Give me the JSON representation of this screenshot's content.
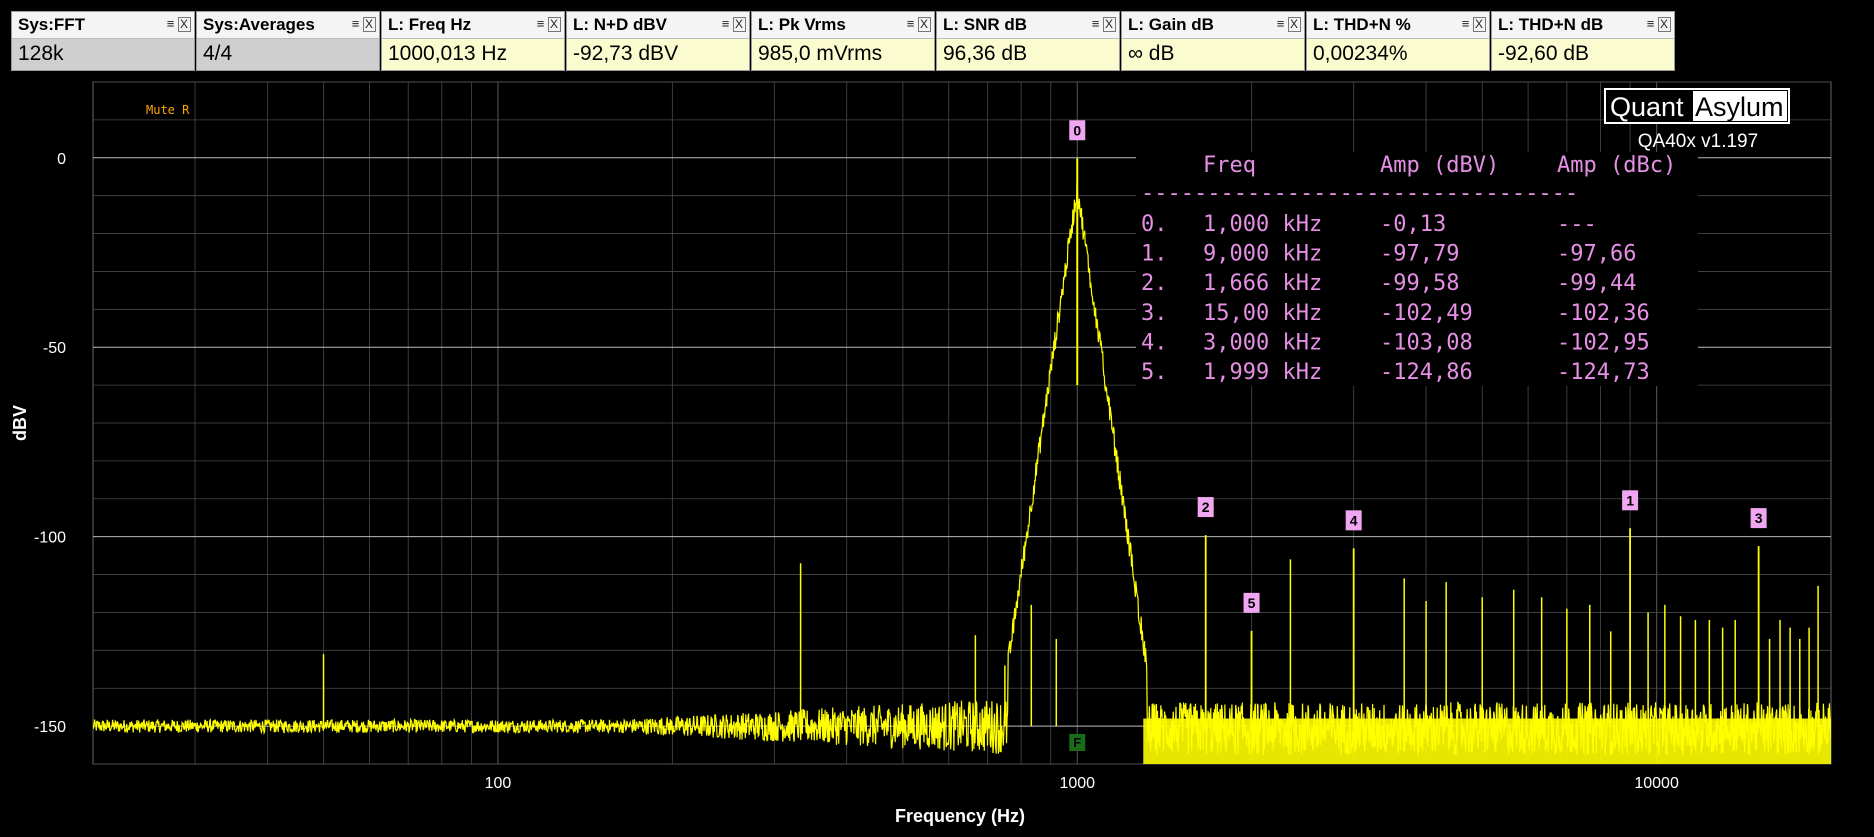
{
  "widgets": [
    {
      "title": "Sys:FFT",
      "value": "128k",
      "kind": "sys"
    },
    {
      "title": "Sys:Averages",
      "value": "4/4",
      "kind": "sys"
    },
    {
      "title": "L: Freq Hz",
      "value": "1000,013 Hz",
      "kind": "meas"
    },
    {
      "title": "L: N+D dBV",
      "value": "-92,73 dBV",
      "kind": "meas"
    },
    {
      "title": "L: Pk Vrms",
      "value": "985,0 mVrms",
      "kind": "meas"
    },
    {
      "title": "L: SNR dB",
      "value": "96,36 dB",
      "kind": "meas"
    },
    {
      "title": "L: Gain dB",
      "value": "∞ dB",
      "kind": "meas"
    },
    {
      "title": "L: THD+N %",
      "value": "0,00234%",
      "kind": "meas"
    },
    {
      "title": "L: THD+N dB",
      "value": "-92,60 dB",
      "kind": "meas"
    }
  ],
  "widget_icons": {
    "menu": "≡",
    "close": "X"
  },
  "branding": {
    "logo_left": "Quant",
    "logo_right": "Asylum",
    "version": "QA40x v1.197"
  },
  "mute_label": "Mute R",
  "fundamental_marker": "F",
  "harmonic_table": {
    "header": [
      "Freq",
      "Amp (dBV)",
      "Amp (dBc)"
    ],
    "separator": "---------------------------------",
    "rows": [
      [
        "0.",
        "1,000 kHz",
        "-0,13",
        "---"
      ],
      [
        "1.",
        "9,000 kHz",
        "-97,79",
        "-97,66"
      ],
      [
        "2.",
        "1,666 kHz",
        "-99,58",
        "-99,44"
      ],
      [
        "3.",
        "15,00 kHz",
        "-102,49",
        "-102,36"
      ],
      [
        "4.",
        "3,000 kHz",
        "-103,08",
        "-102,95"
      ],
      [
        "5.",
        "1,999 kHz",
        "-124,86",
        "-124,73"
      ]
    ]
  },
  "colors": {
    "trace": "#ffff00",
    "grid": "#4a4a4a",
    "marker": "#f1a6f1",
    "table_text": "#e58fe5",
    "mute": "#ffa500",
    "fundamental_marker": "#1a6b1a"
  },
  "chart_data": {
    "type": "line",
    "xlabel": "Frequency (Hz)",
    "ylabel": "dBV",
    "xscale": "log",
    "xlim": [
      20,
      20000
    ],
    "ylim": [
      -160,
      20
    ],
    "xticks": [
      {
        "value": 100,
        "label": "100"
      },
      {
        "value": 1000,
        "label": "1000"
      },
      {
        "value": 10000,
        "label": "10000"
      }
    ],
    "yticks": [
      {
        "value": 0,
        "label": "0"
      },
      {
        "value": -50,
        "label": "-50"
      },
      {
        "value": -100,
        "label": "-100"
      },
      {
        "value": -150,
        "label": "-150"
      }
    ],
    "grid": true,
    "noise_floor_dbv": -150,
    "fundamental": {
      "freq": 1000,
      "dbv": -0.13
    },
    "harmonic_markers": [
      {
        "label": "0",
        "freq": 1000,
        "dbv": -0.13
      },
      {
        "label": "1",
        "freq": 9000,
        "dbv": -97.79
      },
      {
        "label": "2",
        "freq": 1666,
        "dbv": -99.58
      },
      {
        "label": "3",
        "freq": 15000,
        "dbv": -102.49
      },
      {
        "label": "4",
        "freq": 3000,
        "dbv": -103.08
      },
      {
        "label": "5",
        "freq": 1999,
        "dbv": -124.86
      }
    ],
    "spurs": [
      {
        "freq": 50,
        "dbv": -131
      },
      {
        "freq": 333,
        "dbv": -107
      },
      {
        "freq": 667,
        "dbv": -126
      },
      {
        "freq": 750,
        "dbv": -134
      },
      {
        "freq": 833,
        "dbv": -118
      },
      {
        "freq": 920,
        "dbv": -127
      },
      {
        "freq": 2333,
        "dbv": -106
      },
      {
        "freq": 3667,
        "dbv": -111
      },
      {
        "freq": 4000,
        "dbv": -117
      },
      {
        "freq": 4333,
        "dbv": -112
      },
      {
        "freq": 5000,
        "dbv": -116
      },
      {
        "freq": 5667,
        "dbv": -114
      },
      {
        "freq": 6333,
        "dbv": -116
      },
      {
        "freq": 7000,
        "dbv": -119
      },
      {
        "freq": 7667,
        "dbv": -118
      },
      {
        "freq": 8333,
        "dbv": -125
      },
      {
        "freq": 9667,
        "dbv": -120
      },
      {
        "freq": 10333,
        "dbv": -118
      },
      {
        "freq": 11000,
        "dbv": -121
      },
      {
        "freq": 11667,
        "dbv": -122
      },
      {
        "freq": 12333,
        "dbv": -122
      },
      {
        "freq": 13000,
        "dbv": -124
      },
      {
        "freq": 13667,
        "dbv": -122
      },
      {
        "freq": 15667,
        "dbv": -127
      },
      {
        "freq": 16333,
        "dbv": -122
      },
      {
        "freq": 17000,
        "dbv": -124
      },
      {
        "freq": 17667,
        "dbv": -127
      },
      {
        "freq": 18333,
        "dbv": -124
      },
      {
        "freq": 19000,
        "dbv": -113
      }
    ]
  }
}
